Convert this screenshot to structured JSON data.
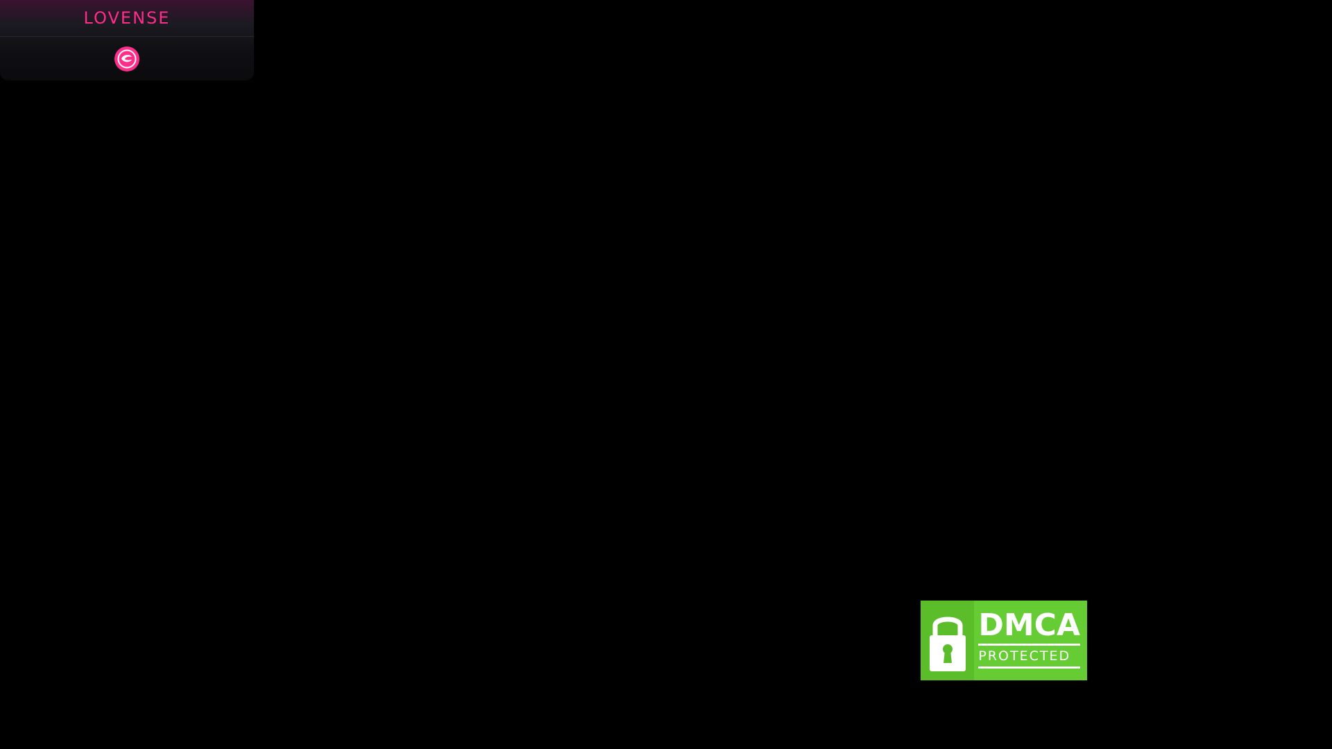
{
  "lovense": {
    "logo_text": "LOVENSE",
    "toy_icon": "lovense-toy-icon",
    "accent_color": "#ff2d8a"
  },
  "dmca": {
    "title": "DMCA",
    "subtitle": "PROTECTED",
    "icon": "padlock-icon",
    "color": "#66cc33"
  },
  "background_color": "#000000"
}
